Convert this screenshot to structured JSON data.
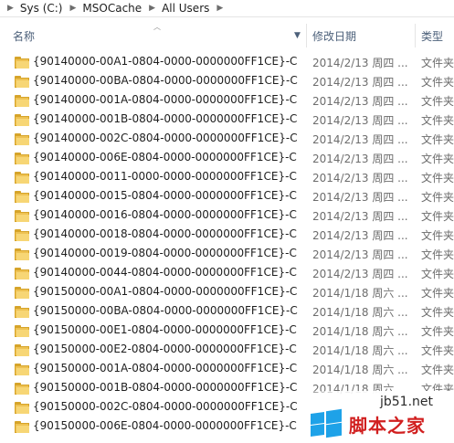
{
  "breadcrumb": [
    "Sys (C:)",
    "MSOCache",
    "All Users"
  ],
  "columns": {
    "name": "名称",
    "date": "修改日期",
    "type": "类型"
  },
  "rows": [
    {
      "name": "{90140000-00A1-0804-0000-0000000FF1CE}-C",
      "date": "2014/2/13 周四 ...",
      "type": "文件夹"
    },
    {
      "name": "{90140000-00BA-0804-0000-0000000FF1CE}-C",
      "date": "2014/2/13 周四 ...",
      "type": "文件夹"
    },
    {
      "name": "{90140000-001A-0804-0000-0000000FF1CE}-C",
      "date": "2014/2/13 周四 ...",
      "type": "文件夹"
    },
    {
      "name": "{90140000-001B-0804-0000-0000000FF1CE}-C",
      "date": "2014/2/13 周四 ...",
      "type": "文件夹"
    },
    {
      "name": "{90140000-002C-0804-0000-0000000FF1CE}-C",
      "date": "2014/2/13 周四 ...",
      "type": "文件夹"
    },
    {
      "name": "{90140000-006E-0804-0000-0000000FF1CE}-C",
      "date": "2014/2/13 周四 ...",
      "type": "文件夹"
    },
    {
      "name": "{90140000-0011-0000-0000-0000000FF1CE}-C",
      "date": "2014/2/13 周四 ...",
      "type": "文件夹"
    },
    {
      "name": "{90140000-0015-0804-0000-0000000FF1CE}-C",
      "date": "2014/2/13 周四 ...",
      "type": "文件夹"
    },
    {
      "name": "{90140000-0016-0804-0000-0000000FF1CE}-C",
      "date": "2014/2/13 周四 ...",
      "type": "文件夹"
    },
    {
      "name": "{90140000-0018-0804-0000-0000000FF1CE}-C",
      "date": "2014/2/13 周四 ...",
      "type": "文件夹"
    },
    {
      "name": "{90140000-0019-0804-0000-0000000FF1CE}-C",
      "date": "2014/2/13 周四 ...",
      "type": "文件夹"
    },
    {
      "name": "{90140000-0044-0804-0000-0000000FF1CE}-C",
      "date": "2014/2/13 周四 ...",
      "type": "文件夹"
    },
    {
      "name": "{90150000-00A1-0804-0000-0000000FF1CE}-C",
      "date": "2014/1/18 周六 ...",
      "type": "文件夹"
    },
    {
      "name": "{90150000-00BA-0804-0000-0000000FF1CE}-C",
      "date": "2014/1/18 周六 ...",
      "type": "文件夹"
    },
    {
      "name": "{90150000-00E1-0804-0000-0000000FF1CE}-C",
      "date": "2014/1/18 周六 ...",
      "type": "文件夹"
    },
    {
      "name": "{90150000-00E2-0804-0000-0000000FF1CE}-C",
      "date": "2014/1/18 周六 ...",
      "type": "文件夹"
    },
    {
      "name": "{90150000-001A-0804-0000-0000000FF1CE}-C",
      "date": "2014/1/18 周六 ...",
      "type": "文件夹"
    },
    {
      "name": "{90150000-001B-0804-0000-0000000FF1CE}-C",
      "date": "2014/1/18 周六 ...",
      "type": "文件夹"
    },
    {
      "name": "{90150000-002C-0804-0000-0000000FF1CE}-C",
      "date": "",
      "type": ""
    },
    {
      "name": "{90150000-006E-0804-0000-0000000FF1CE}-C",
      "date": "",
      "type": ""
    }
  ],
  "watermark": {
    "url": "jb51.net",
    "text": "脚本之家"
  },
  "colors": {
    "folder": "#eec253",
    "header_text": "#4c607a",
    "watermark_red": "#d11f1f",
    "logo_blue": "#1ea2e8"
  },
  "icons": {
    "folder": "folder-icon",
    "breadcrumb_separator": "chevron-right-icon",
    "sort": "sort-up-icon",
    "column_menu": "chevron-down-icon"
  }
}
